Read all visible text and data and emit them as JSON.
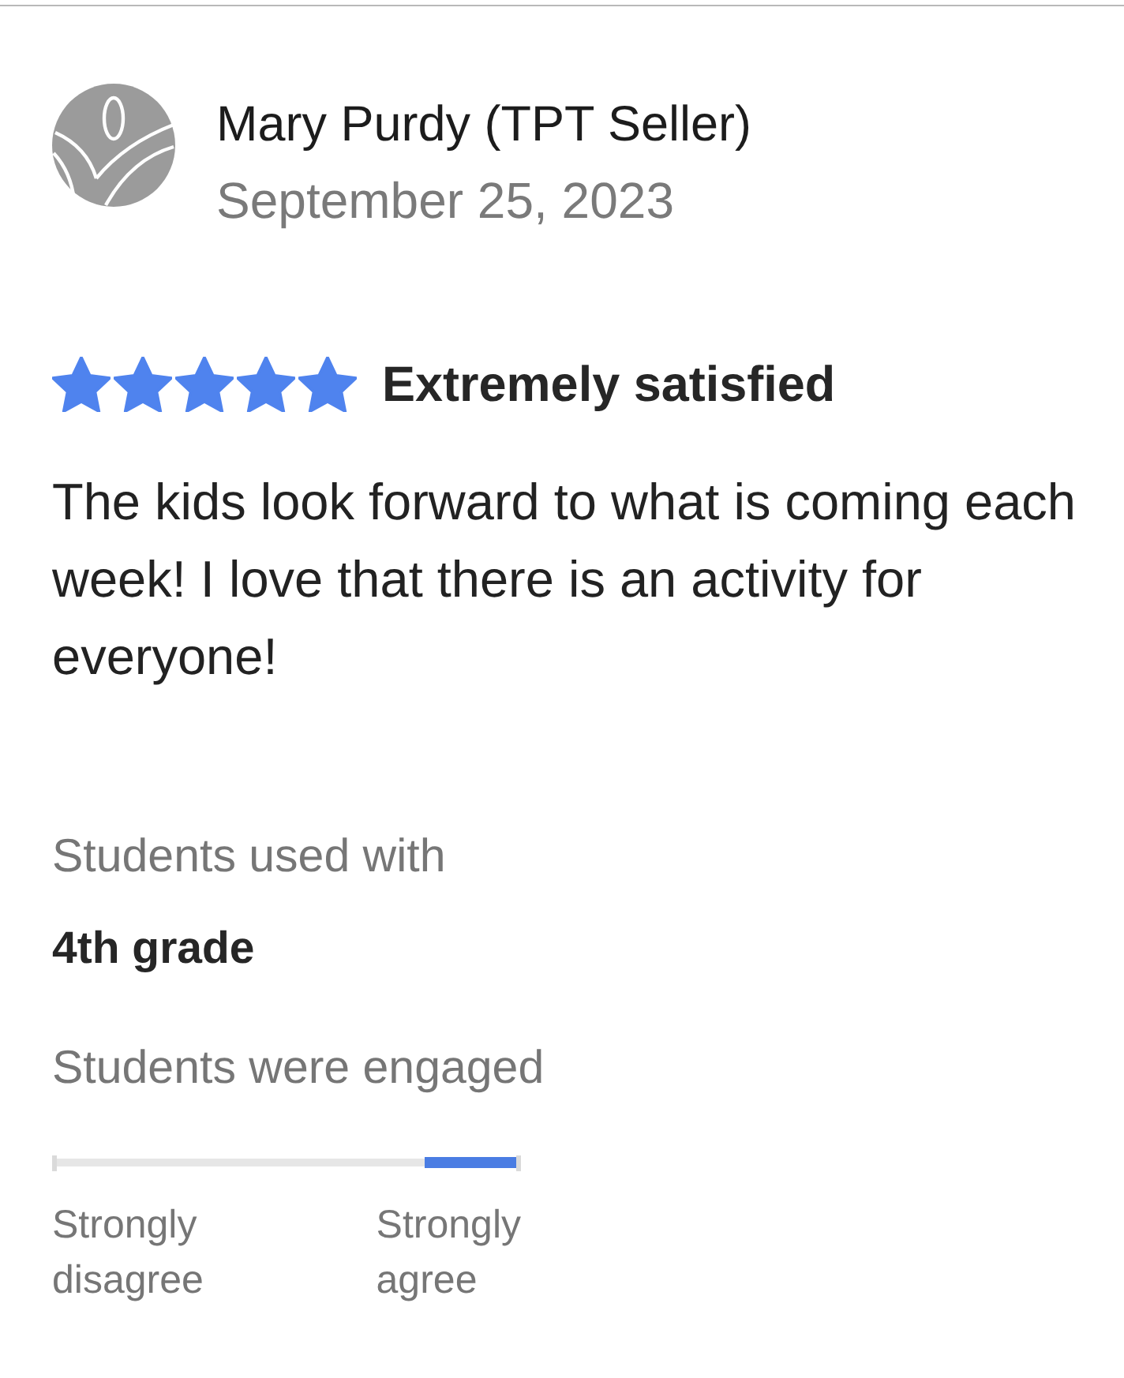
{
  "reviewer": {
    "name": "Mary Purdy (TPT Seller)",
    "date": "September 25, 2023"
  },
  "rating": {
    "stars": 5,
    "label": "Extremely satisfied"
  },
  "review_text": "The kids look forward to what is coming each week! I love that there is an activity for everyone!",
  "details": [
    {
      "kind": "text",
      "label": "Students used with",
      "value": "4th grade"
    },
    {
      "kind": "scale",
      "label": "Students were engaged",
      "points": [
        {
          "selected": false
        },
        {
          "selected": false
        },
        {
          "selected": false
        },
        {
          "selected": false
        },
        {
          "selected": true
        }
      ],
      "min_label": "Strongly disagree",
      "max_label": "Strongly agree"
    }
  ]
}
